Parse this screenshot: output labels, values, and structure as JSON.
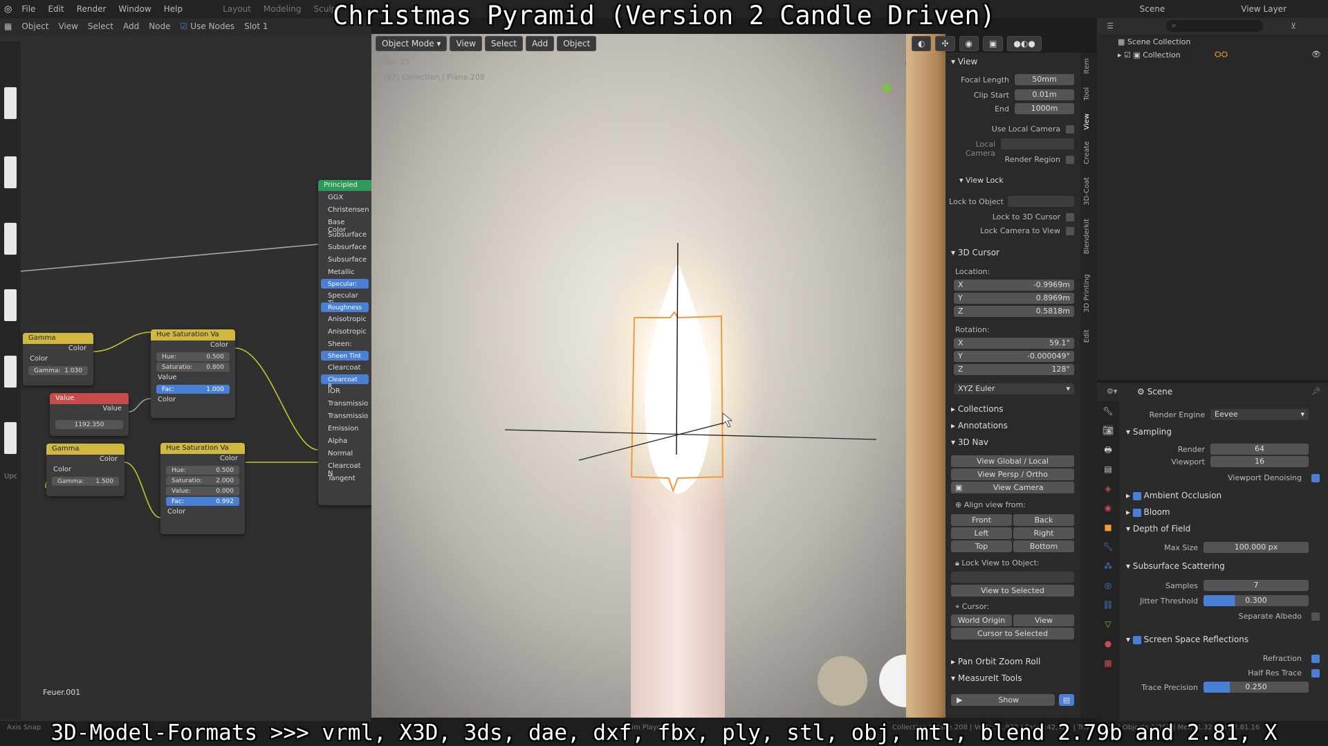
{
  "overlay": {
    "title": "Christmas Pyramid (Version 2 Candle Driven)",
    "bottom": "3D-Model-Formats >>> vrml, X3D, 3ds, dae, dxf, fbx, ply, stl, obj, mtl, blend 2.79b and 2.81, X"
  },
  "menubar": [
    "File",
    "Edit",
    "Render",
    "Window",
    "Help"
  ],
  "workspaces": [
    "Layout",
    "Modeling",
    "Sculpt"
  ],
  "top_right": {
    "scene": "Scene",
    "view_layer": "View Layer"
  },
  "node_header": {
    "items": [
      "Object",
      "View",
      "Select",
      "Add",
      "Node"
    ],
    "use_nodes": "Use Nodes",
    "slot": "Slot 1"
  },
  "nodes": {
    "gamma1": {
      "title": "Gamma",
      "out": "Color",
      "in": "Color",
      "field_label": "Gamma:",
      "field_value": "1.030"
    },
    "value": {
      "title": "Value",
      "out": "Value",
      "field_value": "1192.350"
    },
    "gamma2": {
      "title": "Gamma",
      "out": "Color",
      "in": "Color",
      "field_label": "Gamma:",
      "field_value": "1.500"
    },
    "hsv1": {
      "title": "Hue Saturation Va",
      "out": "Color",
      "fields": [
        [
          "Hue:",
          "0.500"
        ],
        [
          "Saturatio:",
          "0.800"
        ]
      ],
      "value_label": "Value",
      "fac_label": "Fac:",
      "fac_value": "1.000",
      "in": "Color"
    },
    "hsv2": {
      "title": "Hue Saturation Va",
      "out": "Color",
      "fields": [
        [
          "Hue:",
          "0.500"
        ],
        [
          "Saturatio:",
          "2.000"
        ],
        [
          "Value:",
          "0.000"
        ]
      ],
      "fac_label": "Fac:",
      "fac_value": "0.992",
      "in": "Color"
    },
    "principled": {
      "title": "Principled",
      "rows": [
        "GGX",
        "Christensen",
        "Base Color",
        "Subsurface",
        "Subsurface",
        "Subsurface",
        "Metallic",
        "Specular:",
        "Specular Ti",
        "Roughness",
        "Anisotropic",
        "Anisotropic",
        "Sheen:",
        "Sheen Tint",
        "Clearcoat",
        "Clearcoat R",
        "IOR",
        "Transmissio",
        "Transmissio",
        "Emission",
        "Alpha",
        "Normal",
        "Clearcoat N",
        "Tangent"
      ],
      "highlighted": [
        7,
        9,
        13,
        15
      ]
    },
    "frame_label": "Feuer.001",
    "left_label": "Upc"
  },
  "viewport": {
    "header": [
      "Object Mode",
      "View",
      "Select",
      "Add",
      "Object"
    ],
    "fps": "fps: 25",
    "info": "(67) Collection | Plane.208"
  },
  "npanel": {
    "tabs": [
      "Item",
      "Tool",
      "View",
      "Create",
      "3D-Coat",
      "Blenderkit",
      "3D Printing",
      "Edit"
    ],
    "view_section": "View",
    "focal_length_label": "Focal Length",
    "focal_length": "50mm",
    "clip_start_label": "Clip Start",
    "clip_start": "0.01m",
    "clip_end_label": "End",
    "clip_end": "1000m",
    "use_local_camera": "Use Local Camera",
    "local_camera": "Local Camera",
    "render_region": "Render Region",
    "view_lock": "View Lock",
    "lock_to_object": "Lock to Object",
    "lock_to_cursor": "Lock to 3D Cursor",
    "lock_camera": "Lock Camera to View",
    "cursor_section": "3D Cursor",
    "location": "Location:",
    "loc_x_label": "X",
    "loc_x": "-0.9969m",
    "loc_y_label": "Y",
    "loc_y": "0.8969m",
    "loc_z_label": "Z",
    "loc_z": "0.5818m",
    "rotation": "Rotation:",
    "rot_x_label": "X",
    "rot_x": "59.1°",
    "rot_y_label": "Y",
    "rot_y": "-0.000049°",
    "rot_z_label": "Z",
    "rot_z": "128°",
    "rot_mode": "XYZ Euler",
    "collections": "Collections",
    "annotations": "Annotations",
    "nav": "3D Nav",
    "view_global_local": "View Global / Local",
    "view_persp_ortho": "View Persp / Ortho",
    "view_camera": "View Camera",
    "align_view": "Align view from:",
    "front": "Front",
    "back": "Back",
    "left": "Left",
    "right": "Right",
    "top": "Top",
    "bottom": "Bottom",
    "lock_view_to_object": "Lock View to Object:",
    "view_to_selected": "View to Selected",
    "cursor": "Cursor:",
    "world_origin": "World Origin",
    "view": "View",
    "cursor_to_selected": "Cursor to Selected",
    "pan_orbit": "Pan Orbit Zoom Roll",
    "measureit": "MeasureIt Tools",
    "show": "Show"
  },
  "outliner": {
    "scene_collection": "Scene Collection",
    "collection": "Collection"
  },
  "properties": {
    "scene": "Scene",
    "render_engine_label": "Render Engine",
    "render_engine": "Eevee",
    "sampling": "Sampling",
    "render_label": "Render",
    "render": "64",
    "viewport_label": "Viewport",
    "viewport": "16",
    "viewport_denoising": "Viewport Denoising",
    "ambient_occlusion": "Ambient Occlusion",
    "bloom": "Bloom",
    "dof": "Depth of Field",
    "max_size_label": "Max Size",
    "max_size": "100.000 px",
    "sss": "Subsurface Scattering",
    "samples_label": "Samples",
    "samples": "7",
    "jitter_label": "Jitter Threshold",
    "jitter": "0.300",
    "separate_albedo": "Separate Albedo",
    "ssr": "Screen Space Reflections",
    "refraction": "Refraction",
    "half_res": "Half Res Trace",
    "trace_precision_label": "Trace Precision",
    "trace_precision": "0.250"
  },
  "status": {
    "left": "Axis Snap",
    "mid": "Anim Player",
    "right": "Collection | Plane.208 | Verts:31,932 | Faces:42,421 | Tris:84,307 | Objects:1/267 | Mem:1.32 GiB | 2.81.16"
  },
  "colors": {
    "accent": "#4a7fd6",
    "selection": "#f19a3a",
    "node_header_yellow": "#cfb740",
    "node_header_red": "#c84b4b",
    "node_header_green": "#2f9a57"
  }
}
